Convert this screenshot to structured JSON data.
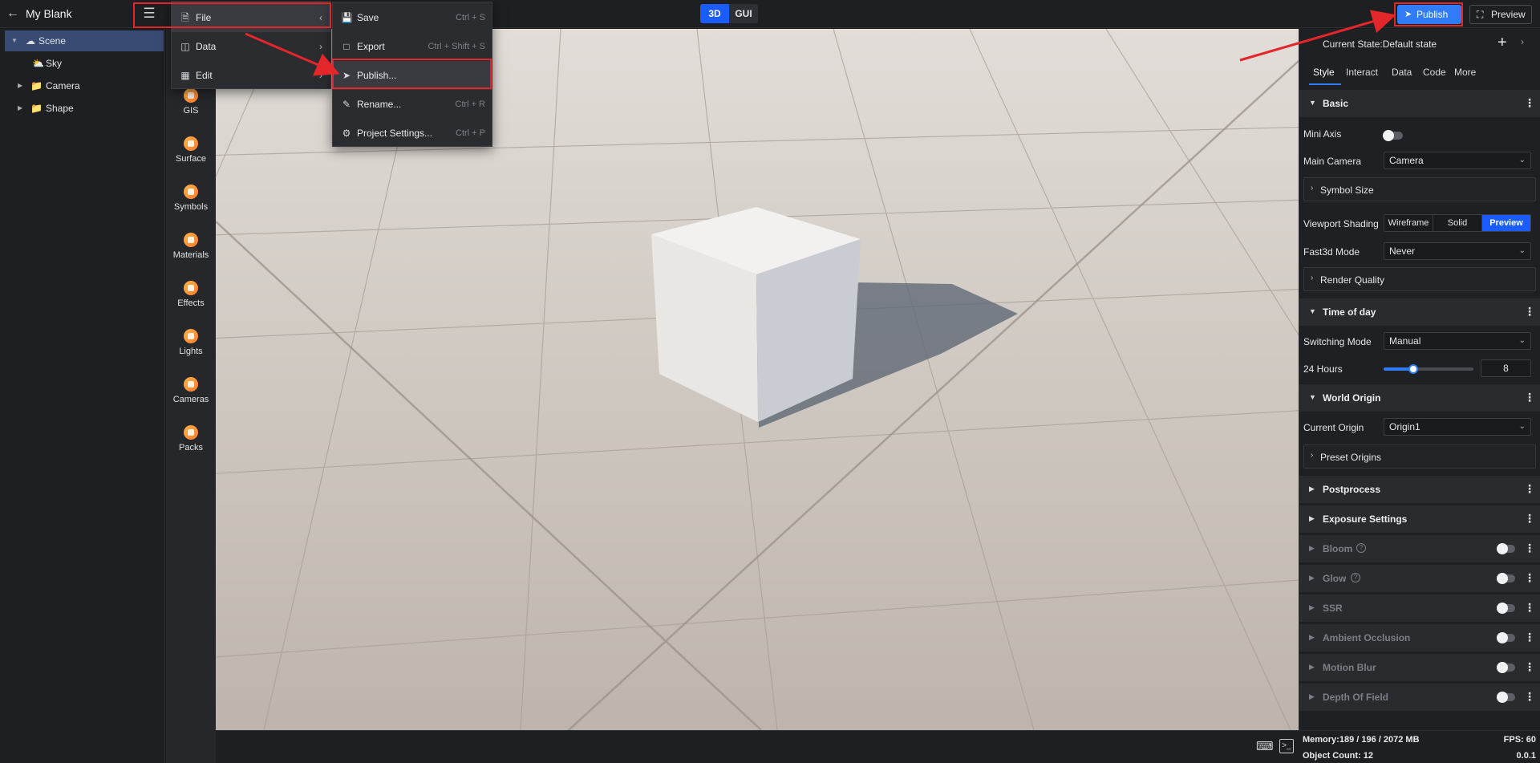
{
  "project_title": "My Blank",
  "mode_switch": {
    "mode_3d": "3D",
    "mode_gui": "GUI"
  },
  "topbar": {
    "publish_label": "Publish",
    "preview_label": "Preview"
  },
  "scene_tree": {
    "items": [
      {
        "label": "Scene",
        "icon": "scene-icon",
        "selected": true
      },
      {
        "label": "Sky",
        "icon": "sky-icon"
      },
      {
        "label": "Camera",
        "icon": "folder-icon"
      },
      {
        "label": "Shape",
        "icon": "folder-icon"
      }
    ]
  },
  "toolbox": {
    "items": [
      {
        "label": "GIS",
        "icon": "gis-icon"
      },
      {
        "label": "Surface",
        "icon": "surface-icon"
      },
      {
        "label": "Symbols",
        "icon": "symbols-icon"
      },
      {
        "label": "Materials",
        "icon": "materials-icon"
      },
      {
        "label": "Effects",
        "icon": "effects-icon"
      },
      {
        "label": "Lights",
        "icon": "lights-icon"
      },
      {
        "label": "Cameras",
        "icon": "cameras-icon"
      },
      {
        "label": "Packs",
        "icon": "packs-icon"
      }
    ]
  },
  "main_menu": {
    "items": [
      {
        "label": "File",
        "icon": "file-icon",
        "active": true
      },
      {
        "label": "Data",
        "icon": "database-icon"
      },
      {
        "label": "Edit",
        "icon": "grid-icon"
      }
    ]
  },
  "file_submenu": {
    "items": [
      {
        "label": "Save",
        "shortcut": "Ctrl + S",
        "icon": "save-icon"
      },
      {
        "label": "Export",
        "shortcut": "Ctrl + Shift + S",
        "icon": "export-icon"
      },
      {
        "label": "Publish...",
        "shortcut": "",
        "icon": "send-icon",
        "active": true
      },
      {
        "label": "Rename...",
        "shortcut": "Ctrl + R",
        "icon": "rename-icon"
      },
      {
        "label": "Project Settings...",
        "shortcut": "Ctrl + P",
        "icon": "settings-icon"
      }
    ]
  },
  "right_panel": {
    "state_label": "Current State:Default state",
    "tabs": [
      "Style",
      "Interact",
      "Data",
      "Code",
      "More"
    ],
    "basic": {
      "title": "Basic",
      "mini_axis_label": "Mini Axis",
      "main_camera_label": "Main Camera",
      "main_camera_value": "Camera",
      "symbol_size_label": "Symbol Size",
      "viewport_shading_label": "Viewport Shading",
      "shading_options": [
        "Wireframe",
        "Solid",
        "Preview"
      ],
      "shading_selected": "Preview",
      "fast3d_label": "Fast3d Mode",
      "fast3d_value": "Never",
      "render_quality_label": "Render Quality"
    },
    "time_of_day": {
      "title": "Time of day",
      "switching_mode_label": "Switching Mode",
      "switching_mode_value": "Manual",
      "hours_label": "24 Hours",
      "hours_value": "8",
      "hours_max": 24
    },
    "world_origin": {
      "title": "World Origin",
      "current_origin_label": "Current Origin",
      "current_origin_value": "Origin1",
      "preset_origins_label": "Preset Origins"
    },
    "postprocess": {
      "title": "Postprocess"
    },
    "exposure": {
      "title": "Exposure Settings"
    },
    "effects": [
      {
        "label": "Bloom",
        "help": true
      },
      {
        "label": "Glow",
        "help": true
      },
      {
        "label": "SSR"
      },
      {
        "label": "Ambient Occlusion"
      },
      {
        "label": "Motion Blur"
      },
      {
        "label": "Depth Of Field"
      }
    ]
  },
  "status_bar": {
    "memory": "Memory:189 / 196 / 2072 MB",
    "fps": "FPS: 60",
    "object_count": "Object Count: 12",
    "version": "0.0.1"
  },
  "colors": {
    "accent": "#2f7cf6",
    "active_blue": "#1b5cff",
    "highlight_red": "#e3262a",
    "panel_bg": "#1f2023"
  }
}
